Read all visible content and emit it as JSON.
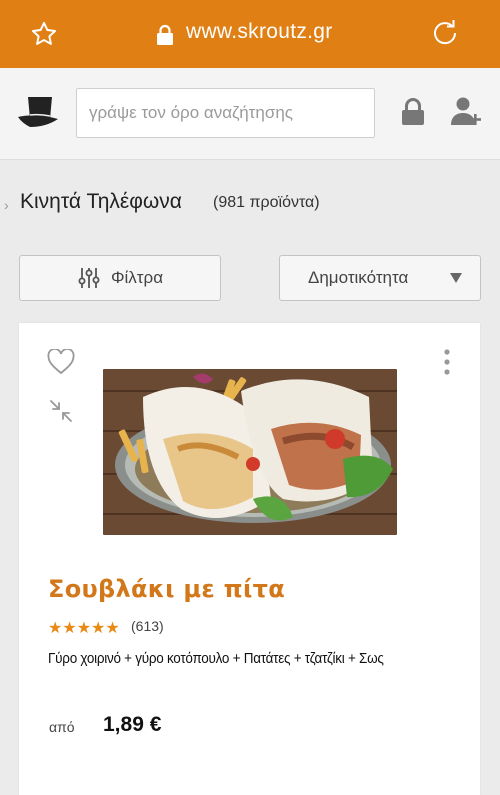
{
  "browser": {
    "url": "www.skroutz.gr",
    "bar_color": "#e07f13"
  },
  "header": {
    "search_placeholder": "γράψε τον όρο αναζήτησης"
  },
  "category": {
    "title": "Κινητά Τηλέφωνα",
    "count": "(981 προϊόντα)"
  },
  "toolbar": {
    "filters_label": "Φίλτρα",
    "sort_label": "Δημοτικότητα"
  },
  "product": {
    "name": "Σουβλάκι με πίτα",
    "rating": 5,
    "stars": "★★★★★",
    "reviews": "(613)",
    "description": "Γύρο χοιρινό + γύρο κοτόπουλο + Πατάτες + τζατζίκι + Σως",
    "from_label": "από",
    "price": "1,89 €",
    "name_color": "#d2781a"
  }
}
